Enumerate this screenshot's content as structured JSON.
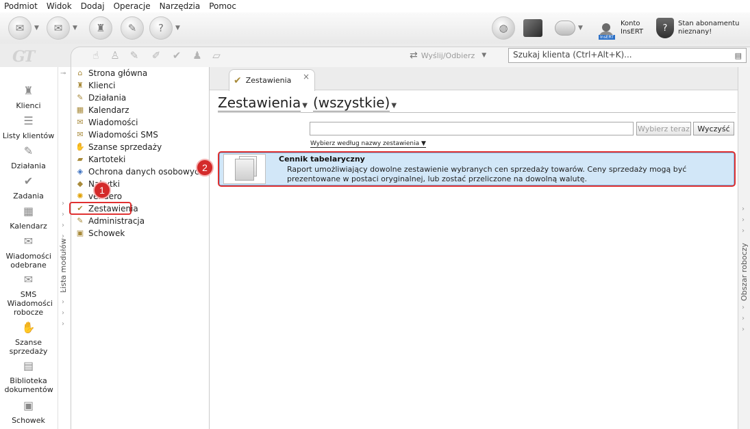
{
  "menu": [
    "Podmiot",
    "Widok",
    "Dodaj",
    "Operacje",
    "Narzędzia",
    "Pomoc"
  ],
  "account": {
    "line1": "Konto",
    "line2": "InsERT",
    "badge": "InsERT"
  },
  "subscription": {
    "line1": "Stan abonamentu",
    "line2": "nieznany!"
  },
  "logo": "GT",
  "send_receive": "Wyślij/Odbierz",
  "search": {
    "placeholder": "Szukaj klienta (Ctrl+Alt+K)..."
  },
  "rail": [
    {
      "name": "Klienci",
      "icon": "clients-icon"
    },
    {
      "name": "Listy klientów",
      "icon": "client-lists-icon"
    },
    {
      "name": "Działania",
      "icon": "actions-icon"
    },
    {
      "name": "Zadania",
      "icon": "tasks-icon"
    },
    {
      "name": "Kalendarz",
      "icon": "calendar-icon"
    },
    {
      "name": "Wiadomości odebrane",
      "icon": "messages-icon"
    },
    {
      "name": "SMS Wiadomości robocze",
      "icon": "sms-icon"
    },
    {
      "name": "Szanse sprzedaży",
      "icon": "sales-opportunities-icon"
    },
    {
      "name": "Biblioteka dokumentów",
      "icon": "document-library-icon"
    },
    {
      "name": "Schowek",
      "icon": "clipboard-icon"
    }
  ],
  "module_panel_label": "Lista modułów",
  "modules": [
    "Strona główna",
    "Klienci",
    "Działania",
    "Kalendarz",
    "Wiadomości",
    "Wiadomości SMS",
    "Szanse sprzedaży",
    "Kartoteki",
    "Ochrona danych osobowych",
    "Nabytki",
    "vendero",
    "Zestawienia",
    "Administracja",
    "Schowek"
  ],
  "selected_module": "Zestawienia",
  "tab": {
    "label": "Zestawienia",
    "close": "×"
  },
  "heading": {
    "title": "Zestawienia",
    "filter": "(wszystkie)"
  },
  "filter": {
    "value": "",
    "apply_label": "Wybierz teraz",
    "clear_label": "Wyczyść"
  },
  "sort_label": "Wybierz według nazwy zestawienia",
  "report": {
    "title": "Cennik tabelaryczny",
    "description": "Raport umożliwiający dowolne zestawienie wybranych cen sprzedaży towarów. Ceny sprzedaży mogą być prezentowane w postaci oryginalnej, lub zostać przeliczone na dowolną walutę."
  },
  "work_area_label": "Obszar roboczy",
  "annotations": {
    "step1": "1",
    "step2": "2"
  },
  "colors": {
    "highlight": "#e03030",
    "selection": "#d2e7f8",
    "badge": "#d42a2a"
  }
}
